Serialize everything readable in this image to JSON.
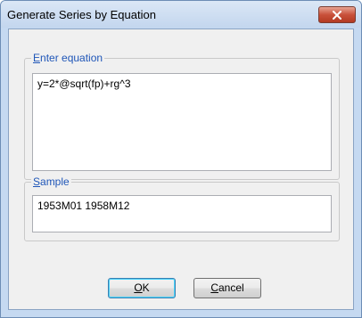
{
  "dialog": {
    "title": "Generate Series by Equation",
    "equation_group": {
      "label_first": "E",
      "label_rest": "nter equation"
    },
    "equation_value": "y=2*@sqrt(fp)+rg^3",
    "sample_group": {
      "label_first": "S",
      "label_rest": "ample"
    },
    "sample_value": "1953M01 1958M12",
    "ok_button": {
      "label_first": "O",
      "label_rest": "K"
    },
    "cancel_button": {
      "label_first": "C",
      "label_rest": "ancel"
    },
    "close_icon": "close-x-icon"
  },
  "colors": {
    "frame": "#c5d9f1",
    "legend_text": "#1f56b8",
    "close_button": "#c9513b"
  }
}
